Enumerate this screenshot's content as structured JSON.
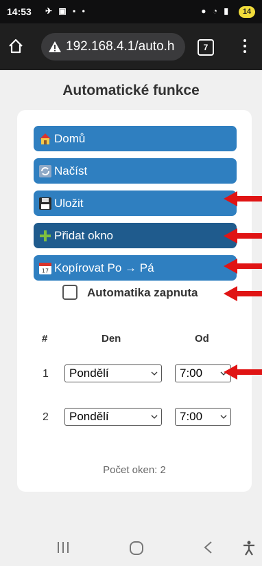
{
  "status_bar": {
    "time": "14:53",
    "notification_count": "14"
  },
  "browser": {
    "url": "192.168.4.1/auto.h",
    "tab_count": "7"
  },
  "page": {
    "title": "Automatické funkce",
    "buttons": {
      "home": "Domů",
      "load": "Načíst",
      "save": "Uložit",
      "add_window": "Přidat okno",
      "copy": "Kopírovat Po → Pá"
    },
    "checkbox": {
      "label": "Automatika zapnuta",
      "checked": false
    },
    "table": {
      "headers": [
        "#",
        "Den",
        "Od"
      ],
      "rows": [
        {
          "num": "1",
          "day": "Pondělí",
          "from": "7:00"
        },
        {
          "num": "2",
          "day": "Pondělí",
          "from": "7:00"
        }
      ]
    },
    "window_count_text": "Počet oken: 2"
  },
  "colors": {
    "button": "#2f7fc0",
    "button_active": "#1f5b8d",
    "annotation_arrow": "#e01414"
  }
}
